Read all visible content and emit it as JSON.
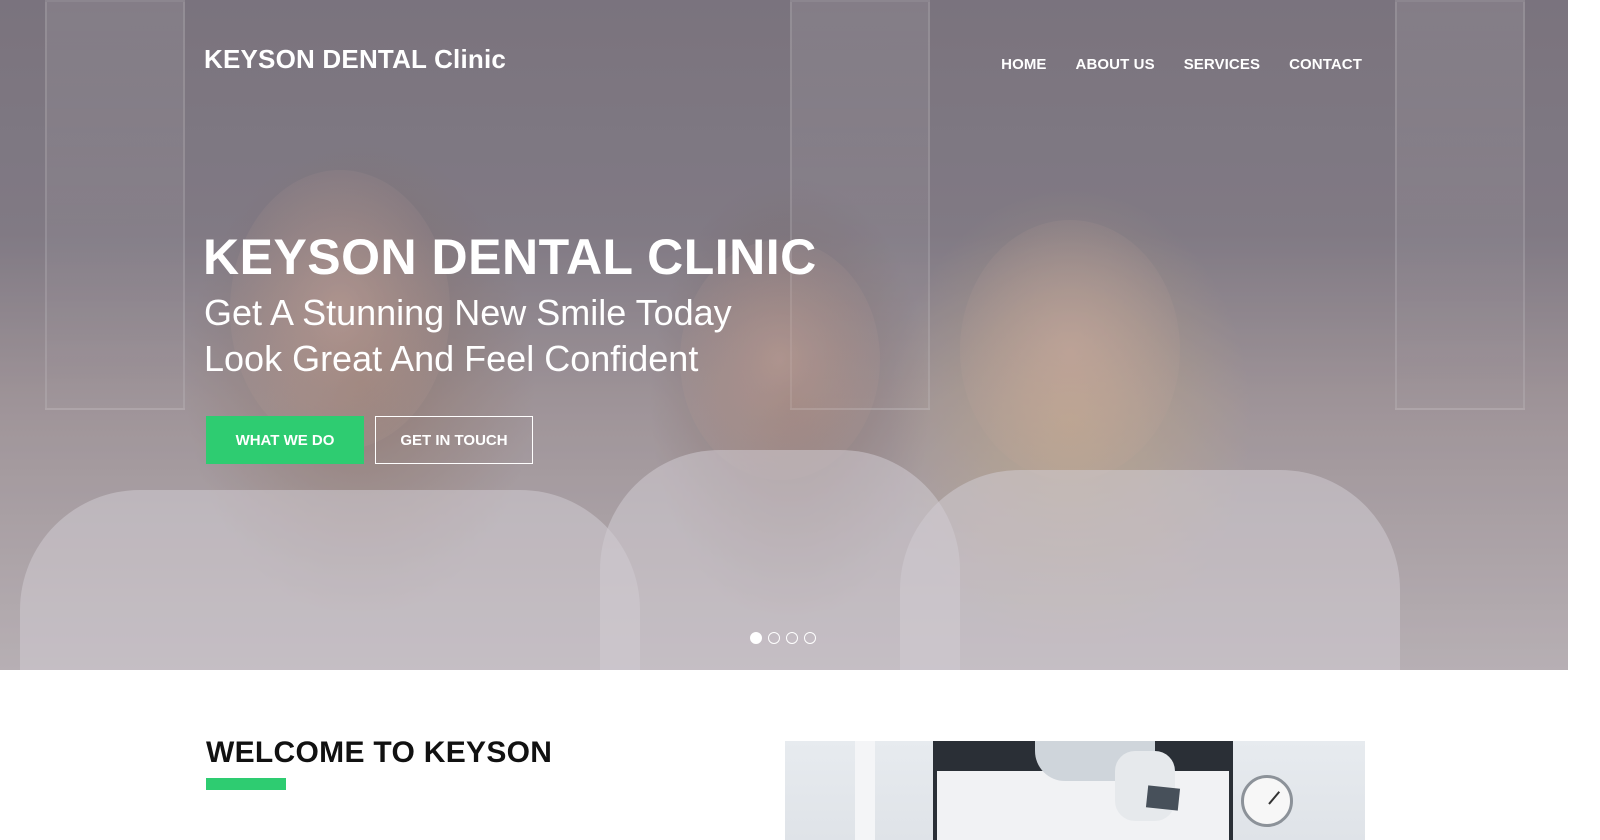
{
  "header": {
    "brand": "KEYSON DENTAL Clinic",
    "nav": [
      "HOME",
      "ABOUT US",
      "SERVICES",
      "CONTACT"
    ]
  },
  "hero": {
    "title": "KEYSON DENTAL CLINIC",
    "line1": "Get A Stunning New Smile Today",
    "line2": "Look Great And Feel Confident",
    "primary_button": "WHAT WE DO",
    "secondary_button": "GET IN TOUCH",
    "slides": {
      "count": 4,
      "active_index": 0
    }
  },
  "welcome": {
    "title": "WELCOME TO KEYSON"
  },
  "colors": {
    "accent": "#2ecc71",
    "text_light": "#ffffff",
    "heading_dark": "#111111"
  }
}
